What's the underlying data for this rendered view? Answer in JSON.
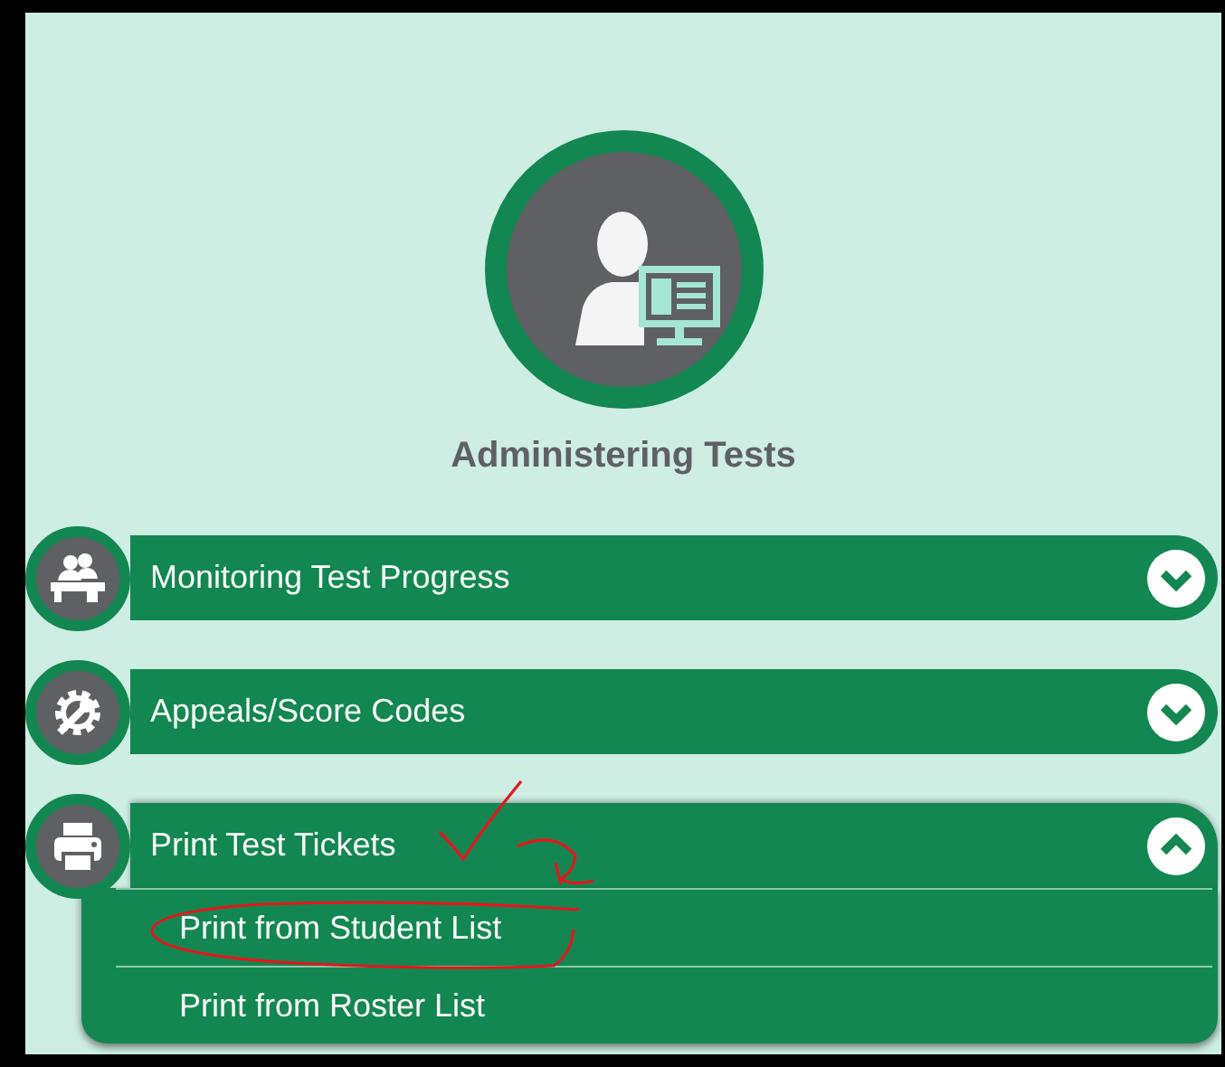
{
  "page_title": "Administering Tests",
  "sections": [
    {
      "label": "Monitoring Test Progress",
      "expanded": false
    },
    {
      "label": "Appeals/Score Codes",
      "expanded": false
    },
    {
      "label": "Print Test Tickets",
      "expanded": true,
      "items": [
        {
          "label": "Print from Student List"
        },
        {
          "label": "Print from Roster List"
        }
      ]
    }
  ]
}
